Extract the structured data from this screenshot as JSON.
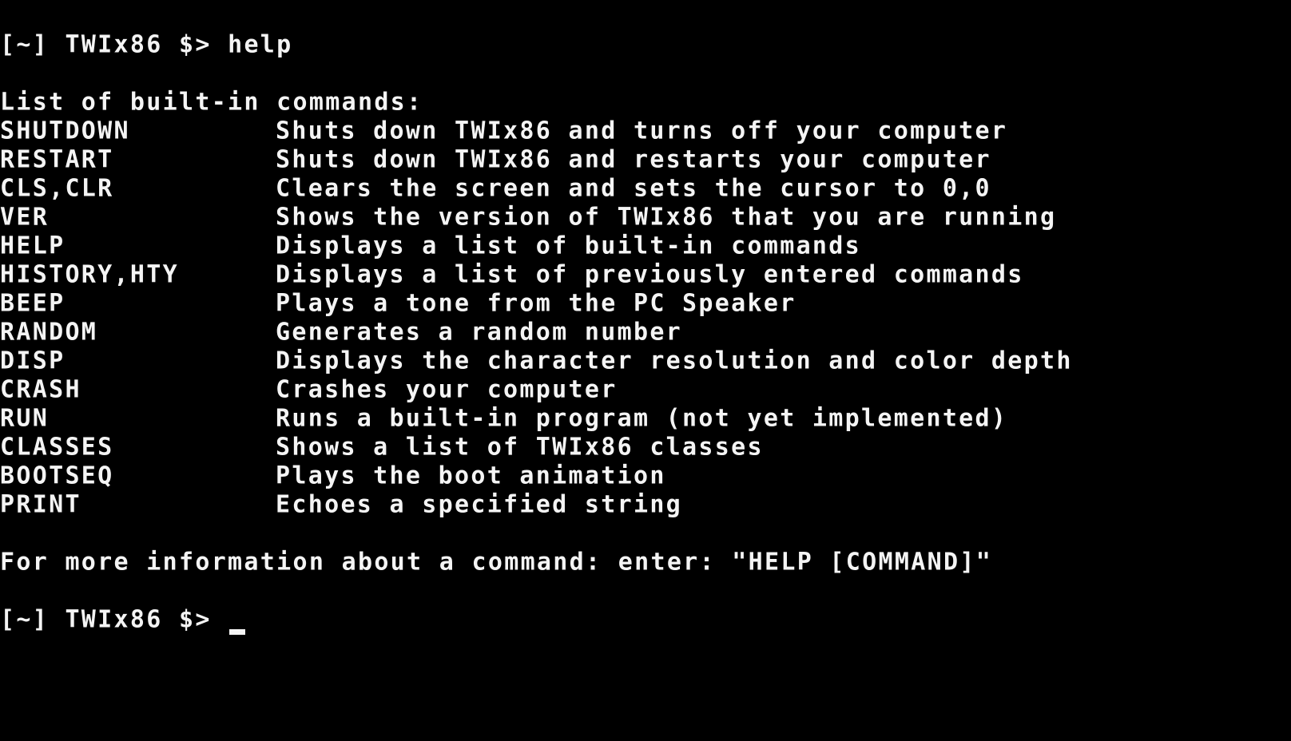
{
  "terminal": {
    "prompt": "[~] TWIx86 $>",
    "first_command": "help",
    "list_header": "List of built-in commands:",
    "commands": [
      {
        "name": "SHUTDOWN",
        "desc": "Shuts down TWIx86 and turns off your computer"
      },
      {
        "name": "RESTART",
        "desc": "Shuts down TWIx86 and restarts your computer"
      },
      {
        "name": "CLS,CLR",
        "desc": "Clears the screen and sets the cursor to 0,0"
      },
      {
        "name": "VER",
        "desc": "Shows the version of TWIx86 that you are running"
      },
      {
        "name": "HELP",
        "desc": "Displays a list of built-in commands"
      },
      {
        "name": "HISTORY,HTY",
        "desc": "Displays a list of previously entered commands"
      },
      {
        "name": "BEEP",
        "desc": "Plays a tone from the PC Speaker"
      },
      {
        "name": "RANDOM",
        "desc": "Generates a random number"
      },
      {
        "name": "DISP",
        "desc": "Displays the character resolution and color depth"
      },
      {
        "name": "CRASH",
        "desc": "Crashes your computer"
      },
      {
        "name": "RUN",
        "desc": "Runs a built-in program (not yet implemented)"
      },
      {
        "name": "CLASSES",
        "desc": "Shows a list of TWIx86 classes"
      },
      {
        "name": "BOOTSEQ",
        "desc": "Plays the boot animation"
      },
      {
        "name": "PRINT",
        "desc": "Echoes a specified string"
      }
    ],
    "footer": "For more information about a command: enter: \"HELP [COMMAND]\"",
    "colors": {
      "background": "#000000",
      "foreground": "#f4f4f4"
    }
  }
}
